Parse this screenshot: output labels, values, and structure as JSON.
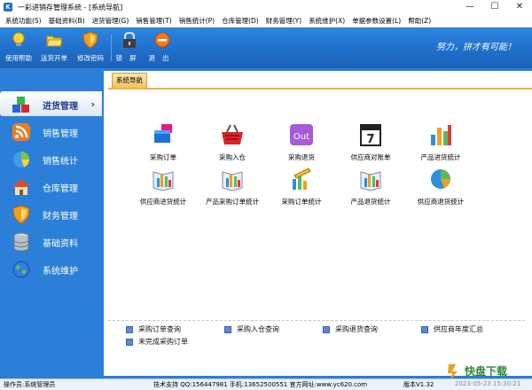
{
  "window": {
    "title": "一彩进销存管理系统 - [系统导航]",
    "controls": [
      "—",
      "☐",
      "✕"
    ]
  },
  "menu": [
    "系统功能(S)",
    "基础资料(B)",
    "进货管理(G)",
    "销售管理(T)",
    "销售统计(P)",
    "仓库管理(D)",
    "财务管理(Y)",
    "系统维护(X)",
    "单据参数设置(L)",
    "帮助(Z)"
  ],
  "toolbar": {
    "help": "使用帮助",
    "delivery": "送货开单",
    "password": "修改密码",
    "lock": "锁屏",
    "exit": "退出",
    "slogan": "努力，拼才有可能！"
  },
  "sidebar": {
    "items": [
      {
        "label": "进货管理",
        "icon": "blocks-icon",
        "active": true
      },
      {
        "label": "销售管理",
        "icon": "rss-icon"
      },
      {
        "label": "销售统计",
        "icon": "pie-chart-icon"
      },
      {
        "label": "仓库管理",
        "icon": "house-icon"
      },
      {
        "label": "财务管理",
        "icon": "shield-icon"
      },
      {
        "label": "基础资料",
        "icon": "database-icon"
      },
      {
        "label": "系统维护",
        "icon": "globe-icon"
      }
    ],
    "chevron": "›"
  },
  "tab": {
    "label": "系统导航"
  },
  "nav_items": [
    {
      "label": "采购订单",
      "icon": "order-icon"
    },
    {
      "label": "采购入仓",
      "icon": "basket-icon"
    },
    {
      "label": "采购退货",
      "icon": "out-icon",
      "icon_text": "Out"
    },
    {
      "label": "供应商对账单",
      "icon": "calendar-icon",
      "icon_text": "7"
    },
    {
      "label": "产品进货统计",
      "icon": "bar-chart-icon"
    },
    {
      "label": "供应商进货统计",
      "icon": "book-chart-icon"
    },
    {
      "label": "产品采购订单统计",
      "icon": "book-chart-icon"
    },
    {
      "label": "采购订单统计",
      "icon": "pencil-chart-icon"
    },
    {
      "label": "产品退货统计",
      "icon": "book-chart-icon"
    },
    {
      "label": "供应商退货统计",
      "icon": "pie-chart-icon"
    }
  ],
  "quick_links": [
    "采购订单查询",
    "采购入仓查询",
    "采购退货查询",
    "供应商年度汇总",
    "未完成采购订单"
  ],
  "status": {
    "operator": "操作员:系统管理员",
    "support": "技术支持 QQ:156447981  手机:13652500551  官方网址:www.yc620.com",
    "version": "版本V1.32",
    "datetime": "2023-05-23 15:30:21"
  },
  "watermark": {
    "text": "快盘下载"
  },
  "colors": {
    "accent": "#2b7fd9",
    "tab": "#f5c15a"
  }
}
